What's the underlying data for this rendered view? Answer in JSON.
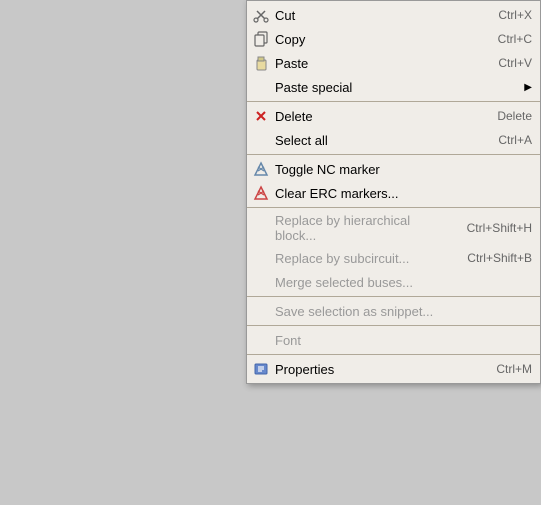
{
  "menu": {
    "items": [
      {
        "id": "cut",
        "label": "Cut",
        "shortcut": "Ctrl+X",
        "disabled": false,
        "has_icon": true,
        "icon": "cut-icon",
        "separator_after": false
      },
      {
        "id": "copy",
        "label": "Copy",
        "shortcut": "Ctrl+C",
        "disabled": false,
        "has_icon": true,
        "icon": "copy-icon",
        "separator_after": false
      },
      {
        "id": "paste",
        "label": "Paste",
        "shortcut": "Ctrl+V",
        "disabled": false,
        "has_icon": true,
        "icon": "paste-icon",
        "separator_after": false
      },
      {
        "id": "paste-special",
        "label": "Paste special",
        "shortcut": "",
        "disabled": false,
        "has_icon": false,
        "icon": "",
        "has_submenu": true,
        "separator_after": true
      },
      {
        "id": "delete",
        "label": "Delete",
        "shortcut": "Delete",
        "disabled": false,
        "has_icon": true,
        "icon": "delete-icon",
        "separator_after": false
      },
      {
        "id": "select-all",
        "label": "Select all",
        "shortcut": "Ctrl+A",
        "disabled": false,
        "has_icon": false,
        "icon": "",
        "separator_after": true
      },
      {
        "id": "toggle-nc",
        "label": "Toggle NC marker",
        "shortcut": "",
        "disabled": false,
        "has_icon": true,
        "icon": "toggle-icon",
        "separator_after": false
      },
      {
        "id": "clear-erc",
        "label": "Clear ERC markers...",
        "shortcut": "",
        "disabled": false,
        "has_icon": true,
        "icon": "clear-icon",
        "separator_after": true
      },
      {
        "id": "replace-hierarchical",
        "label": "Replace by hierarchical block...",
        "shortcut": "Ctrl+Shift+H",
        "disabled": true,
        "has_icon": false,
        "icon": "",
        "separator_after": false
      },
      {
        "id": "replace-subcircuit",
        "label": "Replace by subcircuit...",
        "shortcut": "Ctrl+Shift+B",
        "disabled": true,
        "has_icon": false,
        "icon": "",
        "separator_after": false
      },
      {
        "id": "merge-buses",
        "label": "Merge selected buses...",
        "shortcut": "",
        "disabled": true,
        "has_icon": false,
        "icon": "",
        "separator_after": true
      },
      {
        "id": "save-snippet",
        "label": "Save selection as snippet...",
        "shortcut": "",
        "disabled": true,
        "has_icon": false,
        "icon": "",
        "separator_after": true
      },
      {
        "id": "font",
        "label": "Font",
        "shortcut": "",
        "disabled": true,
        "has_icon": false,
        "icon": "",
        "separator_after": true
      },
      {
        "id": "properties",
        "label": "Properties",
        "shortcut": "Ctrl+M",
        "disabled": false,
        "has_icon": true,
        "icon": "properties-icon",
        "separator_after": false
      }
    ]
  }
}
